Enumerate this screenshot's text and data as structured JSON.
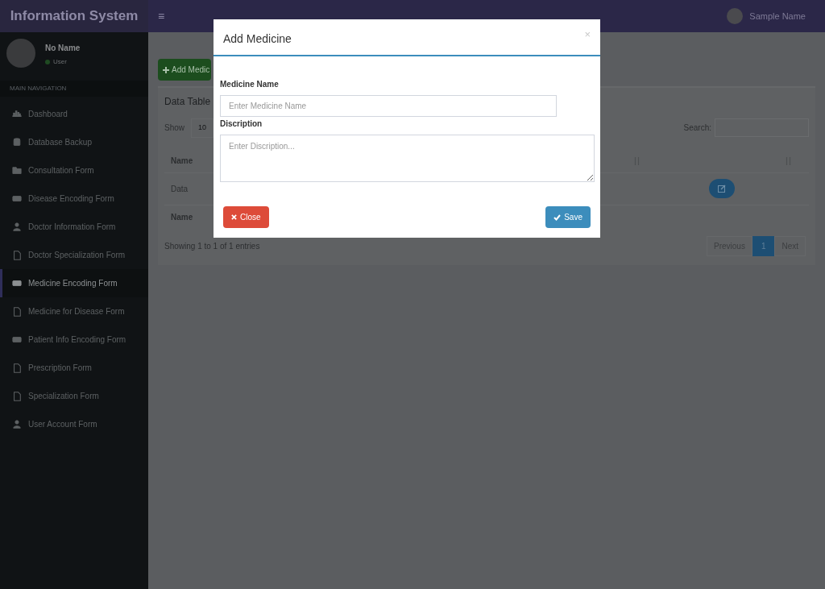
{
  "header": {
    "logo": "Information System",
    "menu_icon": "≡",
    "user_name": "Sample Name"
  },
  "sidebar": {
    "user": {
      "name": "No Name",
      "status": "User",
      "online": true
    },
    "section": "MAIN NAVIGATION",
    "items": [
      {
        "label": "Dashboard",
        "selected": false
      },
      {
        "label": "Database Backup",
        "selected": false
      },
      {
        "label": "Consultation Form",
        "selected": false
      },
      {
        "label": "Disease Encoding Form",
        "selected": false
      },
      {
        "label": "Doctor Information Form",
        "selected": false
      },
      {
        "label": "Doctor Specialization Form",
        "selected": false
      },
      {
        "label": "Medicine Encoding Form",
        "selected": true
      },
      {
        "label": "Medicine for Disease Form",
        "selected": false
      },
      {
        "label": "Patient Info Encoding Form",
        "selected": false
      },
      {
        "label": "Prescription Form",
        "selected": false
      },
      {
        "label": "Specialization Form",
        "selected": false
      },
      {
        "label": "User Account Form",
        "selected": false
      }
    ]
  },
  "content": {
    "add_button": "Add Medic",
    "box_title": "Data Table",
    "show_label": "Show",
    "show_value": "10",
    "search_label": "Search:",
    "table": {
      "columns": [
        "Name"
      ],
      "rows": [
        [
          "Data"
        ]
      ],
      "footer": [
        "Name"
      ]
    },
    "info": "Showing 1 to 1 of 1 entries",
    "pagination": [
      {
        "label": "Previous",
        "selected": false
      },
      {
        "label": "1",
        "selected": true
      },
      {
        "label": "Next",
        "selected": false
      }
    ]
  },
  "modal": {
    "title": "Add Medicine",
    "close_icon": "×",
    "fields": [
      {
        "kind": "input",
        "label": "Medicine Name",
        "placeholder": "Enter Medicine Name"
      },
      {
        "kind": "textarea",
        "label": "Discription",
        "placeholder": "Enter Discription..."
      }
    ],
    "buttons": [
      {
        "kind": "close",
        "label": "Close"
      },
      {
        "kind": "save",
        "label": "Save"
      }
    ]
  }
}
